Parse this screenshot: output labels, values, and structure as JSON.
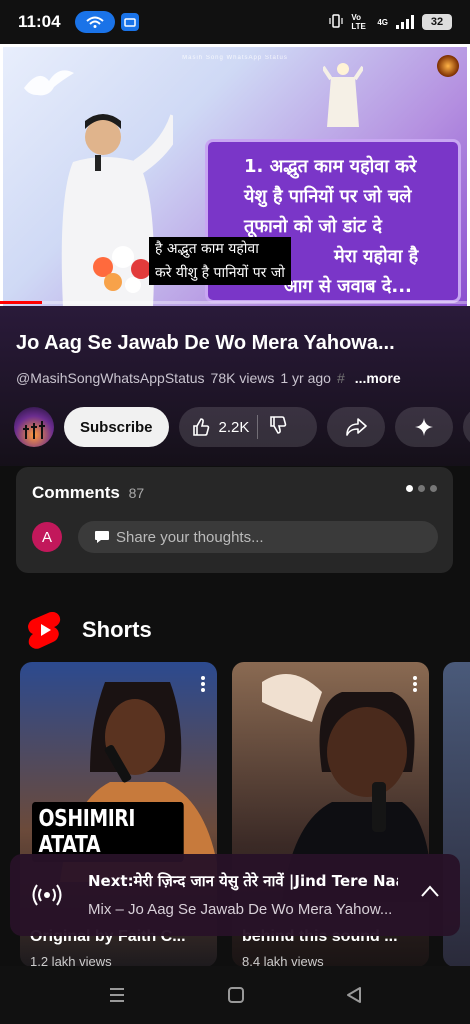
{
  "status_bar": {
    "time": "11:04",
    "battery": "32",
    "network": "4G",
    "volte": "Vo LTE"
  },
  "video": {
    "overlay_channel": "Masih Song WhatsApp Status",
    "lyrics_board": [
      "1. अद्भुत काम यहोवा करे",
      "येशु है पानियों पर जो चले",
      "तूफानो को जो डांट दे",
      "मेरा यहोवा है",
      "आग से जवाब दे..."
    ],
    "subtitle_lines": [
      "है अद्भुत काम यहोवा",
      "करे यीशु है पानियों पर जो"
    ],
    "progress": 0.09
  },
  "info": {
    "title": "Jo Aag Se Jawab De Wo Mera Yahowa...",
    "channel_handle": "@MasihSongWhatsAppStatus",
    "views": "78K views",
    "age": "1 yr ago",
    "hashtag": "#",
    "more_label": "...more"
  },
  "actions": {
    "subscribe_label": "Subscribe",
    "likes": "2.2K"
  },
  "comments": {
    "label": "Comments",
    "count": "87",
    "user_initial": "A",
    "placeholder": "Share your thoughts..."
  },
  "shorts": {
    "section_title": "Shorts",
    "cards": [
      {
        "caption": "OSHIMIRI ATATA",
        "title": "Original by Faith C...",
        "views": "1.2 lakh views"
      },
      {
        "caption": "",
        "title": "behind this sound ...",
        "views": "8.4 lakh views"
      },
      {
        "caption": "",
        "title": "",
        "views": ""
      }
    ]
  },
  "mini_player": {
    "next_label": "Next:मेरी ज़िन्द जान येसु तेरे नावें |Jind Tere Naa...",
    "mix_label": "Mix – Jo Aag Se Jawab De Wo Mera Yahow..."
  },
  "colors": {
    "accent_red": "#ff0000",
    "board_purple": "#7a36c8",
    "avatar_pink": "#c2185b"
  }
}
